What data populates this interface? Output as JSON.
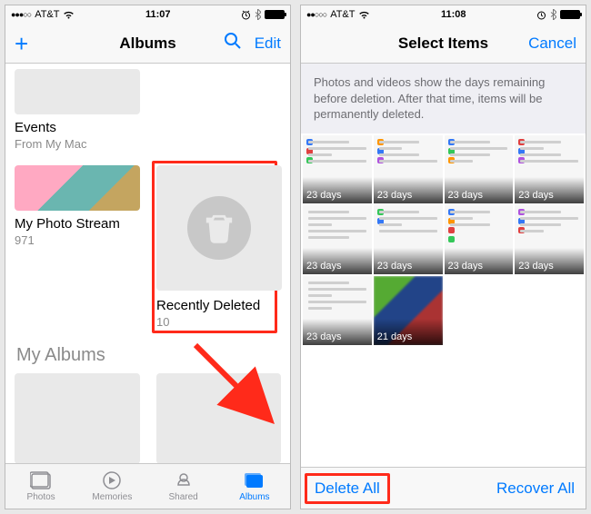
{
  "left": {
    "status": {
      "carrier": "AT&T",
      "time": "11:07"
    },
    "nav": {
      "title": "Albums",
      "edit": "Edit"
    },
    "albums": {
      "events": {
        "title": "Events",
        "sub": "From My Mac"
      },
      "stream": {
        "title": "My Photo Stream",
        "sub": "971"
      },
      "recent": {
        "title": "Recently Deleted",
        "sub": "10"
      }
    },
    "section_my_albums": "My Albums",
    "tabs": {
      "photos": "Photos",
      "memories": "Memories",
      "shared": "Shared",
      "albums": "Albums"
    }
  },
  "right": {
    "status": {
      "carrier": "AT&T",
      "time": "11:08"
    },
    "nav": {
      "title": "Select Items",
      "cancel": "Cancel"
    },
    "banner": "Photos and videos show the days remaining before deletion. After that time, items will be permanently deleted.",
    "days": {
      "d23": "23 days",
      "d21": "21 days"
    },
    "toolbar": {
      "delete": "Delete All",
      "recover": "Recover All"
    }
  }
}
